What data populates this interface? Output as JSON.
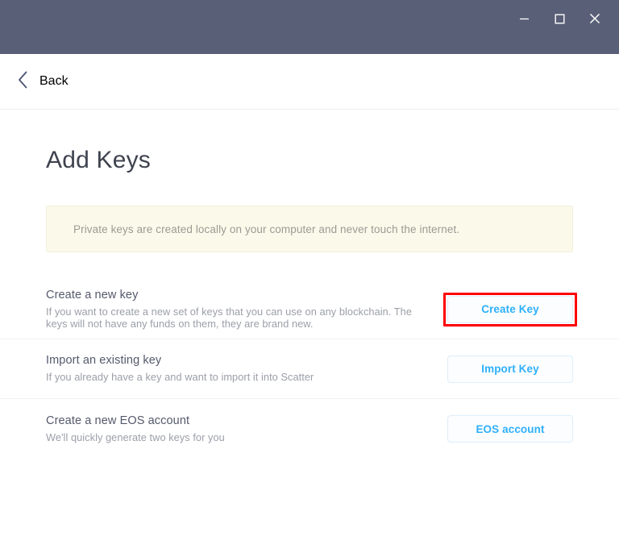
{
  "titlebar": {
    "window_controls": [
      {
        "name": "minimize",
        "icon": "minimize-icon",
        "label": "–"
      },
      {
        "name": "maximize",
        "icon": "maximize-icon",
        "label": "□"
      },
      {
        "name": "close",
        "icon": "close-icon",
        "label": "×"
      }
    ],
    "background_color": "#5a5f78"
  },
  "navbar": {
    "back_icon": "chevron-left-icon",
    "back_label": "Back"
  },
  "main": {
    "page_title": "Add Keys",
    "notice": {
      "text": "Private keys are created locally on your computer and never touch the internet.",
      "background_color": "#fbfaea",
      "border_color": "#f0efdd"
    },
    "rows": [
      {
        "title": "Create a new key",
        "description": "If you want to create a new set of keys that you can use on any blockchain. The keys will not have any funds on them, they are brand new.",
        "button_label": "Create Key",
        "highlighted": true
      },
      {
        "title": "Import an existing key",
        "description": "If you already have a key and want to import it into Scatter",
        "button_label": "Import Key",
        "highlighted": false
      },
      {
        "title": "Create a new EOS account",
        "description": "We'll quickly generate two keys for you",
        "button_label": "EOS account",
        "highlighted": false
      }
    ]
  },
  "colors": {
    "accent_blue": "#2eb0fb",
    "highlight_red": "#fe0000",
    "titlebar": "#5a5f78"
  }
}
